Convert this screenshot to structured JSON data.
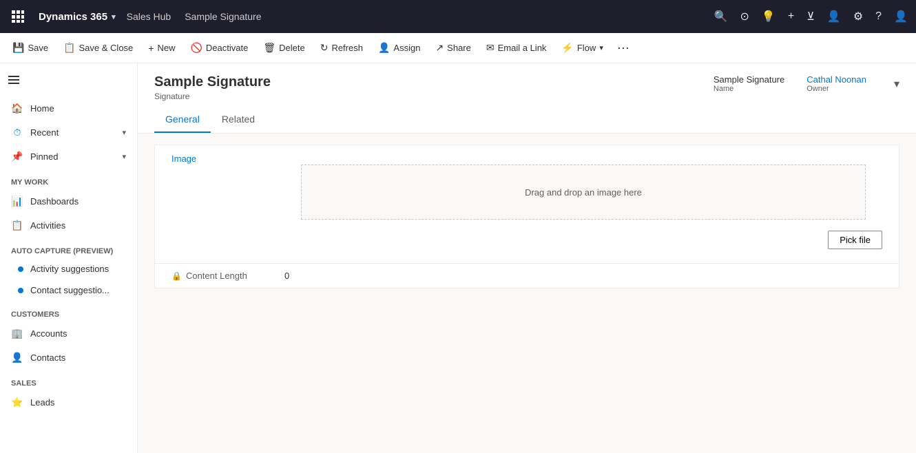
{
  "topNav": {
    "appsLabel": "Apps",
    "brand": "Dynamics 365",
    "brandChevron": "▾",
    "appName": "Sales Hub",
    "recordName": "Sample Signature",
    "icons": [
      "🔍",
      "⊙",
      "💡",
      "+",
      "⊻",
      "👤",
      "⚙",
      "?",
      "👤"
    ]
  },
  "commandBar": {
    "buttons": [
      {
        "id": "save",
        "label": "Save",
        "icon": "💾"
      },
      {
        "id": "save-close",
        "label": "Save & Close",
        "icon": "📋"
      },
      {
        "id": "new",
        "label": "New",
        "icon": "+"
      },
      {
        "id": "deactivate",
        "label": "Deactivate",
        "icon": "🚫"
      },
      {
        "id": "delete",
        "label": "Delete",
        "icon": "🗑"
      },
      {
        "id": "refresh",
        "label": "Refresh",
        "icon": "↻"
      },
      {
        "id": "assign",
        "label": "Assign",
        "icon": "👤"
      },
      {
        "id": "share",
        "label": "Share",
        "icon": "↗"
      },
      {
        "id": "email-link",
        "label": "Email a Link",
        "icon": "✉"
      },
      {
        "id": "flow",
        "label": "Flow",
        "icon": "⚡"
      },
      {
        "id": "more",
        "label": "⋯"
      }
    ]
  },
  "sidebar": {
    "toggleLabel": "Toggle navigation",
    "navItems": [
      {
        "id": "home",
        "label": "Home",
        "icon": "🏠"
      },
      {
        "id": "recent",
        "label": "Recent",
        "icon": "⏱",
        "hasChevron": true
      },
      {
        "id": "pinned",
        "label": "Pinned",
        "icon": "📌",
        "hasChevron": true
      }
    ],
    "sections": [
      {
        "id": "my-work",
        "label": "My Work",
        "items": [
          {
            "id": "dashboards",
            "label": "Dashboards",
            "icon": "📊"
          },
          {
            "id": "activities",
            "label": "Activities",
            "icon": "📋"
          }
        ]
      },
      {
        "id": "auto-capture",
        "label": "Auto capture (preview)",
        "items": [
          {
            "id": "activity-suggestions",
            "label": "Activity suggestions"
          },
          {
            "id": "contact-suggestions",
            "label": "Contact suggestio..."
          }
        ]
      },
      {
        "id": "customers",
        "label": "Customers",
        "items": [
          {
            "id": "accounts",
            "label": "Accounts",
            "icon": "🏢"
          },
          {
            "id": "contacts",
            "label": "Contacts",
            "icon": "👤"
          }
        ]
      },
      {
        "id": "sales",
        "label": "Sales",
        "items": [
          {
            "id": "leads",
            "label": "Leads",
            "icon": "⭐"
          }
        ]
      }
    ]
  },
  "record": {
    "title": "Sample Signature",
    "type": "Signature",
    "tabs": [
      {
        "id": "general",
        "label": "General",
        "active": true
      },
      {
        "id": "related",
        "label": "Related",
        "active": false
      }
    ],
    "summary": {
      "nameField": {
        "label": "Name",
        "value": "Sample Signature"
      },
      "ownerField": {
        "label": "Owner",
        "value": "Cathal Noonan",
        "isLink": true
      }
    }
  },
  "form": {
    "imageDropZoneText": "Drag and drop an image here",
    "imageLabel": "Image",
    "pickFileLabel": "Pick file",
    "contentLengthLabel": "Content Length",
    "contentLengthValue": "0"
  }
}
